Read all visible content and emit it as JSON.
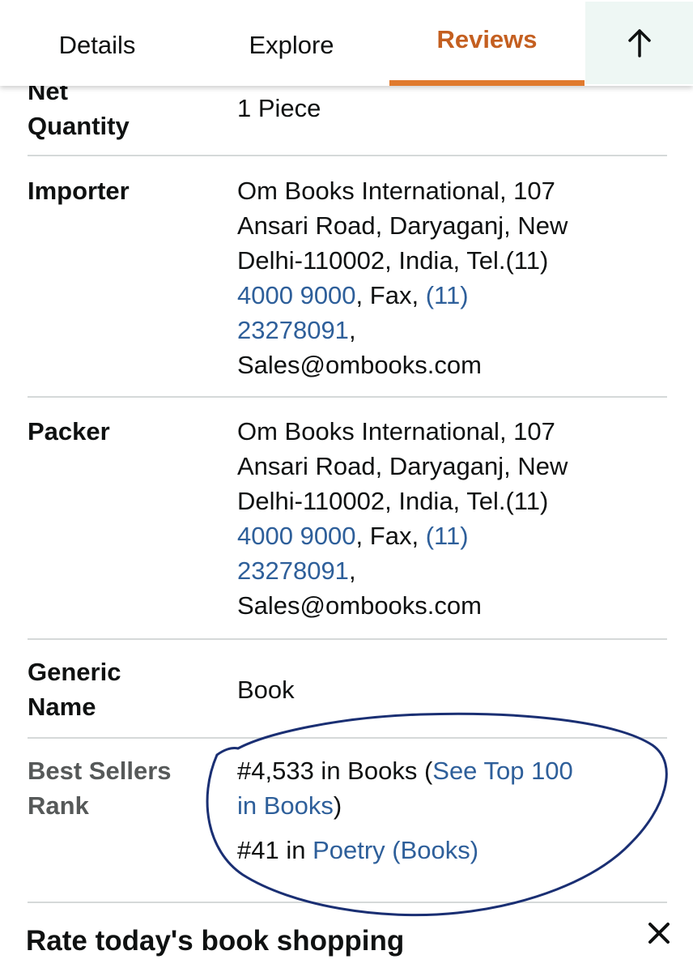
{
  "tabs": {
    "details": "Details",
    "explore": "Explore",
    "reviews": "Reviews",
    "scroll_top_icon": "arrow-up-icon"
  },
  "net_quantity": {
    "label_line1": "Net",
    "label_line2": "Quantity",
    "value": "1 Piece"
  },
  "importer": {
    "label": "Importer",
    "line1": "Om Books International, 107",
    "line2": "Ansari Road, Daryaganj, New",
    "line3": "Delhi-110002, India, Tel.(11)",
    "phone": "4000 9000",
    "fax_text": ", Fax, ",
    "fax_part1": "(11)",
    "fax_part2": "23278091",
    "comma": ",",
    "email": "Sales@ombooks.com"
  },
  "packer": {
    "label": "Packer",
    "line1": "Om Books International, 107",
    "line2": "Ansari Road, Daryaganj, New",
    "line3": "Delhi-110002, India, Tel.(11)",
    "phone": "4000 9000",
    "fax_text": ", Fax, ",
    "fax_part1": "(11)",
    "fax_part2": "23278091",
    "comma": ",",
    "email": "Sales@ombooks.com"
  },
  "generic_name": {
    "label_line1": "Generic",
    "label_line2": "Name",
    "value": "Book"
  },
  "best_sellers": {
    "label_line1": "Best Sellers",
    "label_line2": "Rank",
    "rank1_text": "#4,533 in Books (",
    "rank1_link_part1": "See Top 100",
    "rank1_link_part2": "in Books",
    "rank1_close": ")",
    "rank2_text": "#41 in ",
    "rank2_link": "Poetry (Books)"
  },
  "promo": {
    "title": "Rate today's book shopping",
    "close_icon": "close-icon"
  },
  "colors": {
    "accent": "#c45f20",
    "link": "#2e5f9a",
    "annotation": "#1a2f73"
  }
}
